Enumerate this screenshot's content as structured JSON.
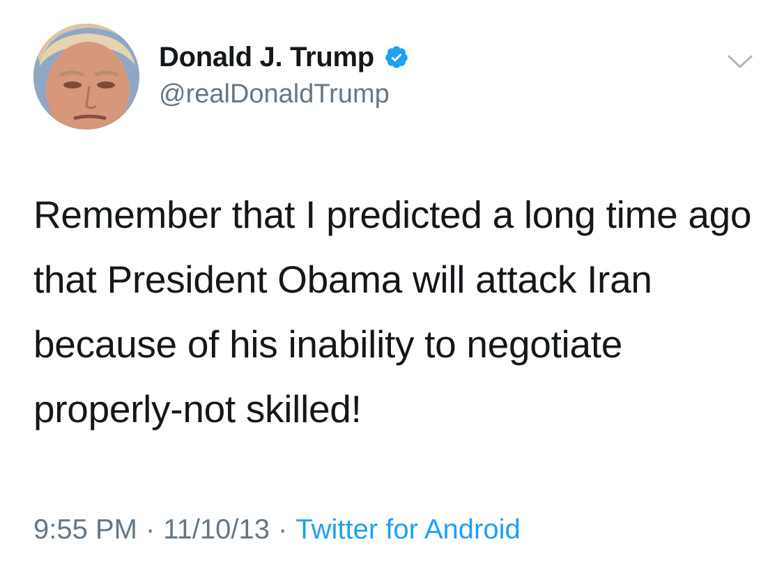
{
  "author": {
    "display_name": "Donald J. Trump",
    "handle": "@realDonaldTrump",
    "verified": true,
    "verified_icon": "verified-badge-icon",
    "avatar": "profile-photo"
  },
  "menu_icon": "chevron-down-icon",
  "tweet": {
    "text": "Remember that I predicted a long time ago that President Obama will attack Iran because of his inability to negotiate properly-not skilled!"
  },
  "meta": {
    "time": "9:55 PM",
    "date": "11/10/13",
    "separator": "·",
    "source": "Twitter for Android"
  },
  "colors": {
    "text": "#14171a",
    "secondary": "#657786",
    "accent": "#1da1f2"
  }
}
